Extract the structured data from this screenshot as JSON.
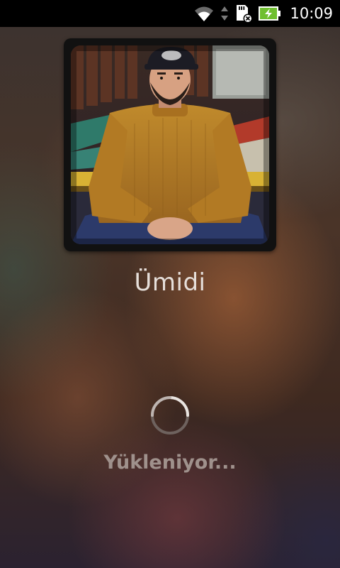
{
  "status_bar": {
    "time": "10:09",
    "icons": [
      "wifi-icon",
      "sync-arrows-icon",
      "sd-card-error-icon",
      "battery-charging-icon"
    ],
    "battery_color": "#6fbf2f"
  },
  "player": {
    "artist_name": "Ümidi",
    "loading_text": "Yükleniyor..."
  },
  "colors": {
    "artist_text": "#e6dfda",
    "loading_text": "#9f918c"
  }
}
